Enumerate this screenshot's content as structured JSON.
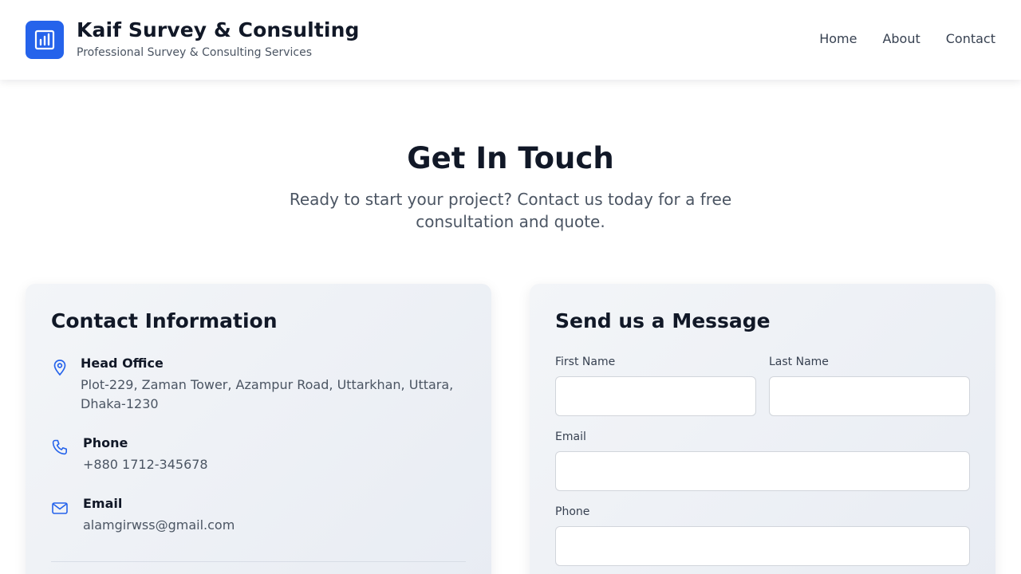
{
  "header": {
    "brand_title": "Kaif Survey & Consulting",
    "brand_subtitle": "Professional Survey & Consulting Services",
    "logo_icon": "bar-chart-icon",
    "nav": [
      {
        "label": "Home"
      },
      {
        "label": "About"
      },
      {
        "label": "Contact"
      }
    ]
  },
  "hero": {
    "title": "Get In Touch",
    "subtitle": "Ready to start your project? Contact us today for a free consultation and quote."
  },
  "contact_info": {
    "title": "Contact Information",
    "items": [
      {
        "icon": "map-pin-icon",
        "label": "Head Office",
        "value": "Plot-229, Zaman Tower, Azampur Road, Uttarkhan, Uttara, Dhaka-1230"
      },
      {
        "icon": "phone-icon",
        "label": "Phone",
        "value": "+880 1712-345678"
      },
      {
        "icon": "mail-icon",
        "label": "Email",
        "value": "alamgirwss@gmail.com"
      }
    ]
  },
  "message_form": {
    "title": "Send us a Message",
    "first_name": {
      "label": "First Name",
      "value": "",
      "placeholder": ""
    },
    "last_name": {
      "label": "Last Name",
      "value": "",
      "placeholder": ""
    },
    "email": {
      "label": "Email",
      "value": "",
      "placeholder": ""
    },
    "phone": {
      "label": "Phone",
      "value": "",
      "placeholder": ""
    }
  },
  "colors": {
    "accent": "#2563eb",
    "heading": "#111827",
    "muted_text": "#4b5563"
  }
}
